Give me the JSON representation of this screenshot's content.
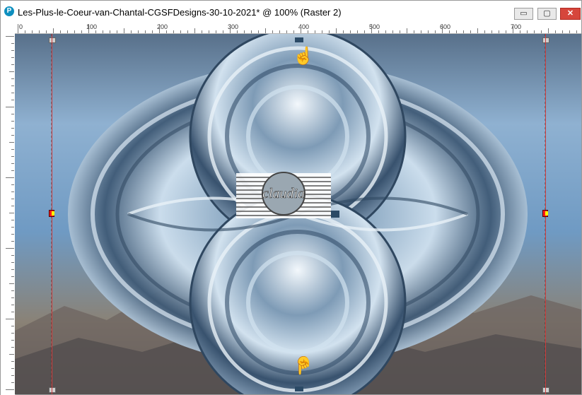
{
  "window": {
    "title": "Les-Plus-le-Coeur-van-Chantal-CGSFDesigns-30-10-2021* @ 100% (Raster 2)",
    "app_icon": "P",
    "controls": {
      "minimize": "▭",
      "maximize": "▢",
      "close": "✕"
    }
  },
  "ruler": {
    "labels": [
      "0",
      "100",
      "200",
      "300",
      "400",
      "500",
      "600",
      "700"
    ]
  },
  "canvas": {
    "zoom": "100%",
    "layer": "Raster 2",
    "watermark_text": "claudia",
    "colors": {
      "sky": "#7aa3c8",
      "steel": "#a9c3da",
      "dark": "#2f4760",
      "mountain": "#7a6a5e"
    }
  },
  "icons": {
    "top_pointer": "pointing-hand-down-icon",
    "bottom_pointer": "pointing-hand-up-icon",
    "left_marker": "edge-marker-icon",
    "right_marker": "edge-marker-icon"
  }
}
